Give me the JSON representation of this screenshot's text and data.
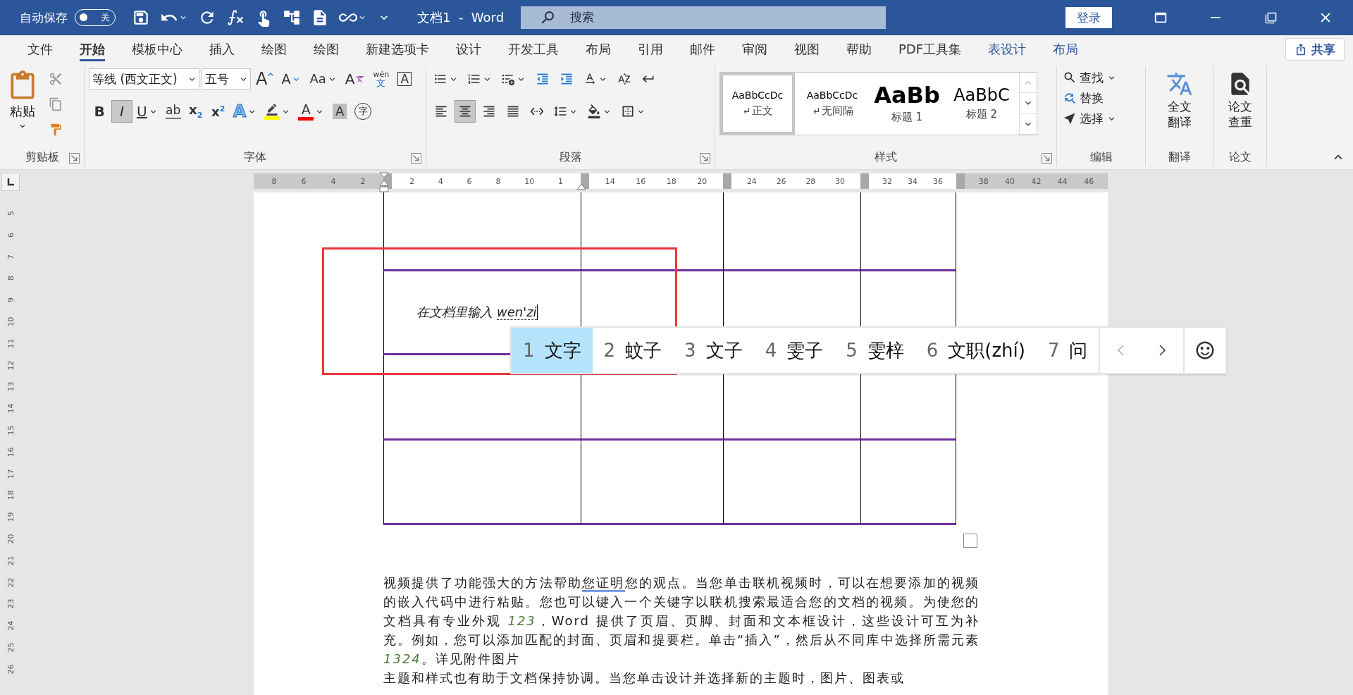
{
  "title_bar": {
    "autosave_label": "自动保存",
    "autosave": {
      "on": false,
      "label": "关"
    },
    "document_title": "文档1  -  Word",
    "search_placeholder": "搜索",
    "login": "登录"
  },
  "tabs": [
    {
      "label": "文件",
      "selected": false,
      "contextual": false
    },
    {
      "label": "开始",
      "selected": true,
      "contextual": false
    },
    {
      "label": "模板中心",
      "selected": false,
      "contextual": false
    },
    {
      "label": "插入",
      "selected": false,
      "contextual": false
    },
    {
      "label": "绘图",
      "selected": false,
      "contextual": false
    },
    {
      "label": "绘图",
      "selected": false,
      "contextual": false
    },
    {
      "label": "新建选项卡",
      "selected": false,
      "contextual": false
    },
    {
      "label": "设计",
      "selected": false,
      "contextual": false
    },
    {
      "label": "开发工具",
      "selected": false,
      "contextual": false
    },
    {
      "label": "布局",
      "selected": false,
      "contextual": false
    },
    {
      "label": "引用",
      "selected": false,
      "contextual": false
    },
    {
      "label": "邮件",
      "selected": false,
      "contextual": false
    },
    {
      "label": "审阅",
      "selected": false,
      "contextual": false
    },
    {
      "label": "视图",
      "selected": false,
      "contextual": false
    },
    {
      "label": "帮助",
      "selected": false,
      "contextual": false
    },
    {
      "label": "PDF工具集",
      "selected": false,
      "contextual": false
    },
    {
      "label": "表设计",
      "selected": false,
      "contextual": true
    },
    {
      "label": "布局",
      "selected": false,
      "contextual": true
    }
  ],
  "share": "共享",
  "ribbon": {
    "clipboard": {
      "label": "剪贴板",
      "paste": "粘贴"
    },
    "font": {
      "label": "字体",
      "font_name": "等线 (西文正文)",
      "font_size": "五号",
      "row1": [
        {
          "kind": "grow",
          "text": "A"
        },
        {
          "kind": "shrink",
          "text": "A"
        },
        {
          "kind": "case",
          "text": "Aa"
        },
        {
          "kind": "clear",
          "text": "A"
        },
        {
          "kind": "phonetic",
          "text": "wén",
          "sub": "文"
        },
        {
          "kind": "border",
          "text": "A"
        }
      ],
      "row2": [
        {
          "kind": "bold",
          "text": "B",
          "selected": false
        },
        {
          "kind": "italic",
          "text": "I",
          "selected": true
        },
        {
          "kind": "underline",
          "text": "U",
          "selected": false
        },
        {
          "kind": "strike",
          "text": "ab",
          "selected": false
        },
        {
          "kind": "subscript",
          "text": "x$_{2}$",
          "selected": false
        },
        {
          "kind": "superscript",
          "text": "x$^{2}$",
          "selected": false
        },
        {
          "kind": "effects",
          "text": "A"
        },
        {
          "kind": "highlight",
          "color": "#ffff00"
        },
        {
          "kind": "fontcolor",
          "text": "A",
          "color": "#ff0000"
        },
        {
          "kind": "shading",
          "text": "A"
        },
        {
          "kind": "enclose",
          "text": "字"
        }
      ]
    },
    "paragraph": {
      "label": "段落",
      "alignment": [
        {
          "kind": "left",
          "selected": false
        },
        {
          "kind": "center",
          "selected": true
        },
        {
          "kind": "right",
          "selected": false
        },
        {
          "kind": "justify",
          "selected": false
        },
        {
          "kind": "distributed",
          "selected": false
        }
      ]
    },
    "styles": {
      "label": "样式",
      "items": [
        {
          "preview": "AaBbCcDc",
          "name": "正文",
          "kind": "body",
          "selected": true
        },
        {
          "preview": "AaBbCcDc",
          "name": "无间隔",
          "kind": "body",
          "selected": false
        },
        {
          "preview": "AaBb",
          "name": "标题 1",
          "kind": "heading1",
          "selected": false
        },
        {
          "preview": "AaBbC",
          "name": "标题 2",
          "kind": "heading2",
          "selected": false
        }
      ]
    },
    "editing": {
      "label": "编辑",
      "items": [
        {
          "kind": "find",
          "label": "查找"
        },
        {
          "kind": "replace",
          "label": "替换"
        },
        {
          "kind": "select",
          "label": "选择"
        }
      ]
    },
    "translation": {
      "label": "翻译",
      "button": "全文翻译"
    },
    "paper": {
      "label": "论文",
      "button": "论文查重"
    }
  },
  "horizontal_ruler": {
    "segments": [
      {
        "shaded": true,
        "labels": [
          "8",
          "6",
          "4",
          "2"
        ]
      },
      {
        "shaded": false,
        "labels": [
          "2",
          "4",
          "6",
          "8",
          "10",
          "1"
        ]
      },
      {
        "shaded": false,
        "labels": [
          "14",
          "16",
          "18",
          "20"
        ]
      },
      {
        "shaded": false,
        "labels": [
          "24",
          "26",
          "28",
          "30"
        ]
      },
      {
        "shaded": false,
        "labels": [
          "32",
          "34",
          "36"
        ]
      },
      {
        "shaded": true,
        "labels": [
          "38",
          "40",
          "42",
          "44",
          "46"
        ]
      }
    ]
  },
  "vertical_ruler": {
    "labels": [
      "5",
      "6",
      "7",
      "8",
      "9",
      "10",
      "11",
      "12",
      "13",
      "14",
      "15",
      "16",
      "17",
      "18",
      "19",
      "20",
      "21",
      "22",
      "23",
      "24",
      "25",
      "26"
    ]
  },
  "document": {
    "typed_text": "在文档里输入",
    "composition": "wen'zi",
    "paragraphs": [
      {
        "segments": [
          {
            "text": "视频提供了功能强大的方法帮助",
            "kind": "plain"
          },
          {
            "text": "您证明",
            "kind": "flagged"
          },
          {
            "text": "您的观点。当您单击联机视频时，可以在想要添加的视频的嵌入代码中进行粘贴。您也可以键入一个关键字以联机搜索最适合您的文档的视频。为使您的文档具有专业外观 ",
            "kind": "plain"
          },
          {
            "text": "123",
            "kind": "number"
          },
          {
            "text": "，Word 提供了页眉、页脚、封面和文本框设计，这些设计可互为补充。例如，您可以添加匹配的封面、页眉和提要栏。单击“插入”，然后从不同库中选择所需元素 ",
            "kind": "plain"
          },
          {
            "text": "1324",
            "kind": "number"
          },
          {
            "text": "。详见附件图片",
            "kind": "plain"
          }
        ]
      },
      {
        "segments": [
          {
            "text": "主题和样式也有助于文档保持协调。当您单击设计并选择新的主题时，图片、图表或",
            "kind": "plain"
          }
        ]
      }
    ]
  },
  "ime": {
    "candidates": [
      {
        "index": "1",
        "text": "文字",
        "selected": true
      },
      {
        "index": "2",
        "text": "蚊子",
        "selected": false
      },
      {
        "index": "3",
        "text": "文子",
        "selected": false
      },
      {
        "index": "4",
        "text": "雯子",
        "selected": false
      },
      {
        "index": "5",
        "text": "雯梓",
        "selected": false
      },
      {
        "index": "6",
        "text": "文职(zhí)",
        "selected": false
      },
      {
        "index": "7",
        "text": "问",
        "selected": false
      }
    ]
  }
}
